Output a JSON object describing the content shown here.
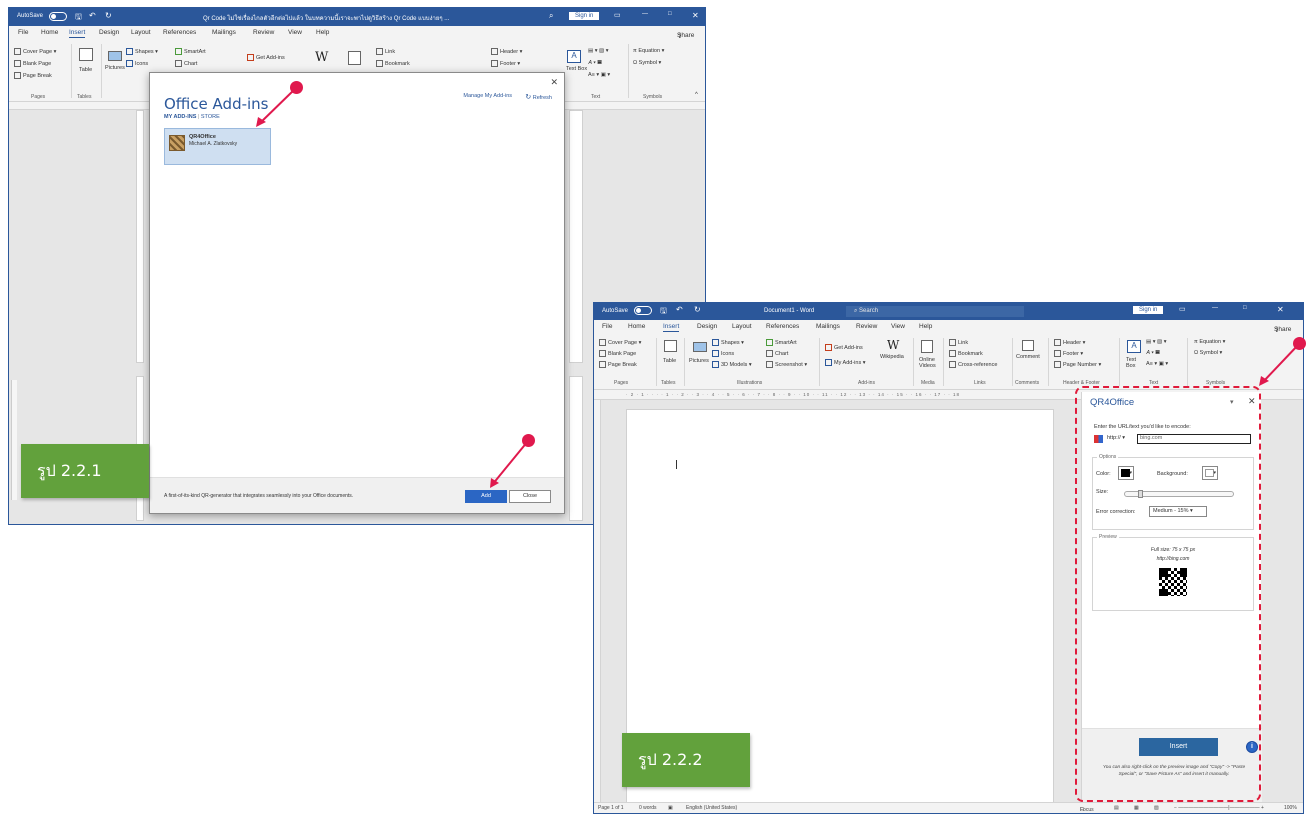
{
  "win1": {
    "autosave": "AutoSave",
    "autosave_state": "Off",
    "title": "Qr Code ไม่ใช่เรื่องไกลตัวอีกต่อไปแล้ว ในบทความนี้เราจะพาไปดูวิธีสร้าง Qr Code แบบง่ายๆ ...",
    "sign_in": "Sign in",
    "share": "Share",
    "tabs": [
      "File",
      "Home",
      "Insert",
      "Design",
      "Layout",
      "References",
      "Mailings",
      "Review",
      "View",
      "Help"
    ],
    "ribbon": {
      "cover_page": "Cover Page",
      "blank_page": "Blank Page",
      "page_break": "Page Break",
      "table": "Table",
      "pictures": "Pictures",
      "shapes": "Shapes",
      "icons": "Icons",
      "smartart": "SmartArt",
      "chart": "Chart",
      "get_addins": "Get Add-ins",
      "link": "Link",
      "bookmark": "Bookmark",
      "header": "Header",
      "footer": "Footer",
      "text_box": "Text Box",
      "equation": "Equation",
      "symbol": "Symbol",
      "groups": [
        "Pages",
        "Tables",
        "Text",
        "Symbols"
      ]
    },
    "dialog": {
      "title": "Office Add-ins",
      "tab_my": "MY ADD-INS",
      "tab_store": "STORE",
      "manage": "Manage My Add-ins",
      "refresh": "Refresh",
      "addin_name": "QR4Office",
      "addin_author": "Michael A. Zlatkovsky",
      "description": "A first-of-its-kind QR-generator that integrates seamlessly into your Office documents.",
      "add": "Add",
      "close": "Close"
    }
  },
  "win2": {
    "autosave": "AutoSave",
    "autosave_state": "Off",
    "title": "Document1 - Word",
    "search": "Search",
    "sign_in": "Sign in",
    "share": "Share",
    "tabs": [
      "File",
      "Home",
      "Insert",
      "Design",
      "Layout",
      "References",
      "Mailings",
      "Review",
      "View",
      "Help"
    ],
    "ribbon": {
      "cover_page": "Cover Page",
      "blank_page": "Blank Page",
      "page_break": "Page Break",
      "table": "Table",
      "pictures": "Pictures",
      "shapes": "Shapes",
      "icons": "Icons",
      "models": "3D Models",
      "smartart": "SmartArt",
      "chart": "Chart",
      "screenshot": "Screenshot",
      "get_addins": "Get Add-ins",
      "my_addins": "My Add-ins",
      "wikipedia": "Wikipedia",
      "online_videos": "Online Videos",
      "link": "Link",
      "bookmark": "Bookmark",
      "cross_reference": "Cross-reference",
      "comment": "Comment",
      "header": "Header",
      "footer": "Footer",
      "page_number": "Page Number",
      "text_box": "Text Box",
      "equation": "Equation",
      "symbol": "Symbol",
      "groups": [
        "Pages",
        "Tables",
        "Illustrations",
        "Add-ins",
        "Media",
        "Links",
        "Comments",
        "Header & Footer",
        "Text",
        "Symbols"
      ]
    },
    "status": {
      "page": "Page 1 of 1",
      "words": "0 words",
      "language": "English (United States)",
      "focus": "Focus",
      "zoom": "100%"
    },
    "pane": {
      "title": "QR4Office",
      "prompt": "Enter the URL/text you'd like to encode:",
      "protocol": "http://",
      "url_value": "bing.com",
      "options_legend": "Options",
      "color_label": "Color:",
      "background_label": "Background:",
      "size_label": "Size:",
      "size_fraction": 0.12,
      "error_label": "Error correction:",
      "error_value": "Medium - 15%",
      "preview_legend": "Preview",
      "full_size": "Full size: 75 x 75 px",
      "preview_url": "http://bing.com",
      "insert": "Insert",
      "info": "i",
      "note": "You can also right-click on the preview image and \"Copy\" -> \"Paste Special\", or \"Save Picture As\" and insert it manually."
    }
  },
  "labels": {
    "fig1": "รูป 2.2.1",
    "fig2": "รูป 2.2.2"
  },
  "colors": {
    "word_blue": "#2b579a",
    "annotation_red": "#e0194d",
    "label_green": "#62a13c"
  }
}
